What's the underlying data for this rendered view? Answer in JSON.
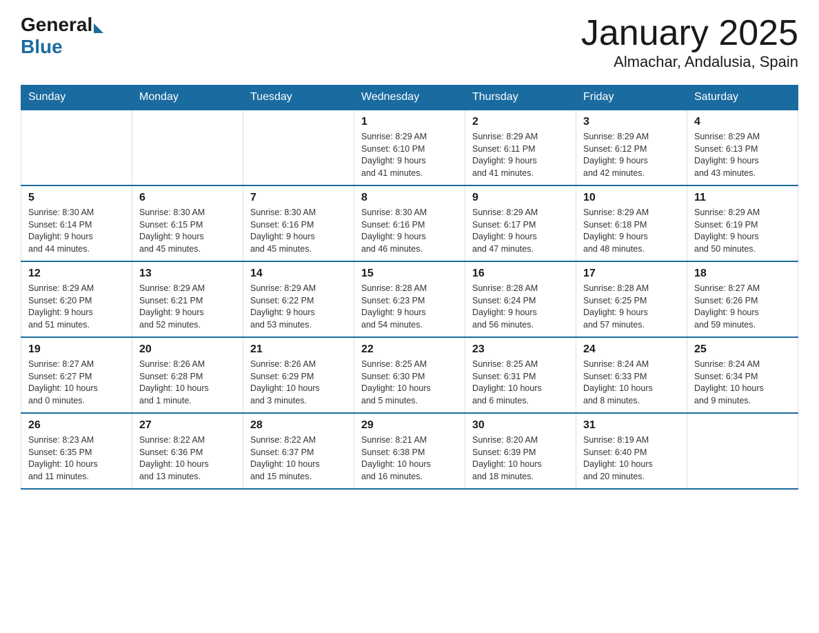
{
  "header": {
    "logo_general": "General",
    "logo_blue": "Blue",
    "month_title": "January 2025",
    "location": "Almachar, Andalusia, Spain"
  },
  "days_of_week": [
    "Sunday",
    "Monday",
    "Tuesday",
    "Wednesday",
    "Thursday",
    "Friday",
    "Saturday"
  ],
  "weeks": [
    [
      {
        "day": "",
        "info": ""
      },
      {
        "day": "",
        "info": ""
      },
      {
        "day": "",
        "info": ""
      },
      {
        "day": "1",
        "info": "Sunrise: 8:29 AM\nSunset: 6:10 PM\nDaylight: 9 hours\nand 41 minutes."
      },
      {
        "day": "2",
        "info": "Sunrise: 8:29 AM\nSunset: 6:11 PM\nDaylight: 9 hours\nand 41 minutes."
      },
      {
        "day": "3",
        "info": "Sunrise: 8:29 AM\nSunset: 6:12 PM\nDaylight: 9 hours\nand 42 minutes."
      },
      {
        "day": "4",
        "info": "Sunrise: 8:29 AM\nSunset: 6:13 PM\nDaylight: 9 hours\nand 43 minutes."
      }
    ],
    [
      {
        "day": "5",
        "info": "Sunrise: 8:30 AM\nSunset: 6:14 PM\nDaylight: 9 hours\nand 44 minutes."
      },
      {
        "day": "6",
        "info": "Sunrise: 8:30 AM\nSunset: 6:15 PM\nDaylight: 9 hours\nand 45 minutes."
      },
      {
        "day": "7",
        "info": "Sunrise: 8:30 AM\nSunset: 6:16 PM\nDaylight: 9 hours\nand 45 minutes."
      },
      {
        "day": "8",
        "info": "Sunrise: 8:30 AM\nSunset: 6:16 PM\nDaylight: 9 hours\nand 46 minutes."
      },
      {
        "day": "9",
        "info": "Sunrise: 8:29 AM\nSunset: 6:17 PM\nDaylight: 9 hours\nand 47 minutes."
      },
      {
        "day": "10",
        "info": "Sunrise: 8:29 AM\nSunset: 6:18 PM\nDaylight: 9 hours\nand 48 minutes."
      },
      {
        "day": "11",
        "info": "Sunrise: 8:29 AM\nSunset: 6:19 PM\nDaylight: 9 hours\nand 50 minutes."
      }
    ],
    [
      {
        "day": "12",
        "info": "Sunrise: 8:29 AM\nSunset: 6:20 PM\nDaylight: 9 hours\nand 51 minutes."
      },
      {
        "day": "13",
        "info": "Sunrise: 8:29 AM\nSunset: 6:21 PM\nDaylight: 9 hours\nand 52 minutes."
      },
      {
        "day": "14",
        "info": "Sunrise: 8:29 AM\nSunset: 6:22 PM\nDaylight: 9 hours\nand 53 minutes."
      },
      {
        "day": "15",
        "info": "Sunrise: 8:28 AM\nSunset: 6:23 PM\nDaylight: 9 hours\nand 54 minutes."
      },
      {
        "day": "16",
        "info": "Sunrise: 8:28 AM\nSunset: 6:24 PM\nDaylight: 9 hours\nand 56 minutes."
      },
      {
        "day": "17",
        "info": "Sunrise: 8:28 AM\nSunset: 6:25 PM\nDaylight: 9 hours\nand 57 minutes."
      },
      {
        "day": "18",
        "info": "Sunrise: 8:27 AM\nSunset: 6:26 PM\nDaylight: 9 hours\nand 59 minutes."
      }
    ],
    [
      {
        "day": "19",
        "info": "Sunrise: 8:27 AM\nSunset: 6:27 PM\nDaylight: 10 hours\nand 0 minutes."
      },
      {
        "day": "20",
        "info": "Sunrise: 8:26 AM\nSunset: 6:28 PM\nDaylight: 10 hours\nand 1 minute."
      },
      {
        "day": "21",
        "info": "Sunrise: 8:26 AM\nSunset: 6:29 PM\nDaylight: 10 hours\nand 3 minutes."
      },
      {
        "day": "22",
        "info": "Sunrise: 8:25 AM\nSunset: 6:30 PM\nDaylight: 10 hours\nand 5 minutes."
      },
      {
        "day": "23",
        "info": "Sunrise: 8:25 AM\nSunset: 6:31 PM\nDaylight: 10 hours\nand 6 minutes."
      },
      {
        "day": "24",
        "info": "Sunrise: 8:24 AM\nSunset: 6:33 PM\nDaylight: 10 hours\nand 8 minutes."
      },
      {
        "day": "25",
        "info": "Sunrise: 8:24 AM\nSunset: 6:34 PM\nDaylight: 10 hours\nand 9 minutes."
      }
    ],
    [
      {
        "day": "26",
        "info": "Sunrise: 8:23 AM\nSunset: 6:35 PM\nDaylight: 10 hours\nand 11 minutes."
      },
      {
        "day": "27",
        "info": "Sunrise: 8:22 AM\nSunset: 6:36 PM\nDaylight: 10 hours\nand 13 minutes."
      },
      {
        "day": "28",
        "info": "Sunrise: 8:22 AM\nSunset: 6:37 PM\nDaylight: 10 hours\nand 15 minutes."
      },
      {
        "day": "29",
        "info": "Sunrise: 8:21 AM\nSunset: 6:38 PM\nDaylight: 10 hours\nand 16 minutes."
      },
      {
        "day": "30",
        "info": "Sunrise: 8:20 AM\nSunset: 6:39 PM\nDaylight: 10 hours\nand 18 minutes."
      },
      {
        "day": "31",
        "info": "Sunrise: 8:19 AM\nSunset: 6:40 PM\nDaylight: 10 hours\nand 20 minutes."
      },
      {
        "day": "",
        "info": ""
      }
    ]
  ]
}
